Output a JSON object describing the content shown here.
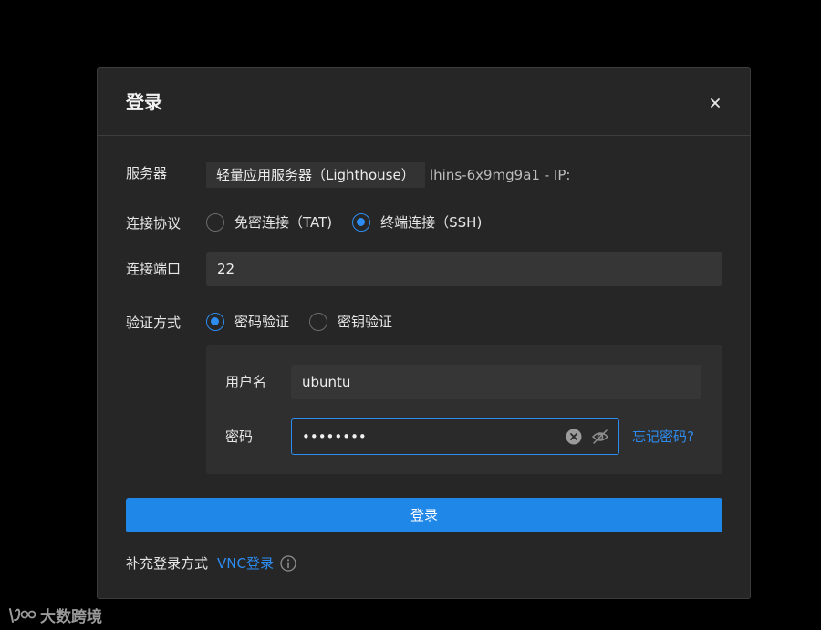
{
  "dialog": {
    "title": "登录",
    "close_icon": "close-icon"
  },
  "server": {
    "label": "服务器",
    "name": "轻量应用服务器（Lighthouse）",
    "instance": "lhins-6x9mg9a1 - IP: "
  },
  "protocol": {
    "label": "连接协议",
    "options": [
      {
        "label": "免密连接（TAT)",
        "checked": false
      },
      {
        "label": "终端连接（SSH)",
        "checked": true
      }
    ]
  },
  "port": {
    "label": "连接端口",
    "value": "22"
  },
  "auth": {
    "label": "验证方式",
    "options": [
      {
        "label": "密码验证",
        "checked": true
      },
      {
        "label": "密钥验证",
        "checked": false
      }
    ],
    "username_label": "用户名",
    "username_value": "ubuntu",
    "password_label": "密码",
    "password_mask": "••••••••",
    "clear_icon": "clear-icon",
    "visibility_icon": "eye-off-icon",
    "forgot_link": "忘记密码?"
  },
  "login_button": "登录",
  "extra": {
    "label": "补充登录方式",
    "vnc_link": "VNC登录",
    "info_icon": "info-icon"
  },
  "watermark": {
    "text": "大数跨境"
  },
  "colors": {
    "accent": "#2d8cf0",
    "button": "#1f87e8",
    "dialog_bg": "#262626",
    "page_bg": "#000000"
  }
}
